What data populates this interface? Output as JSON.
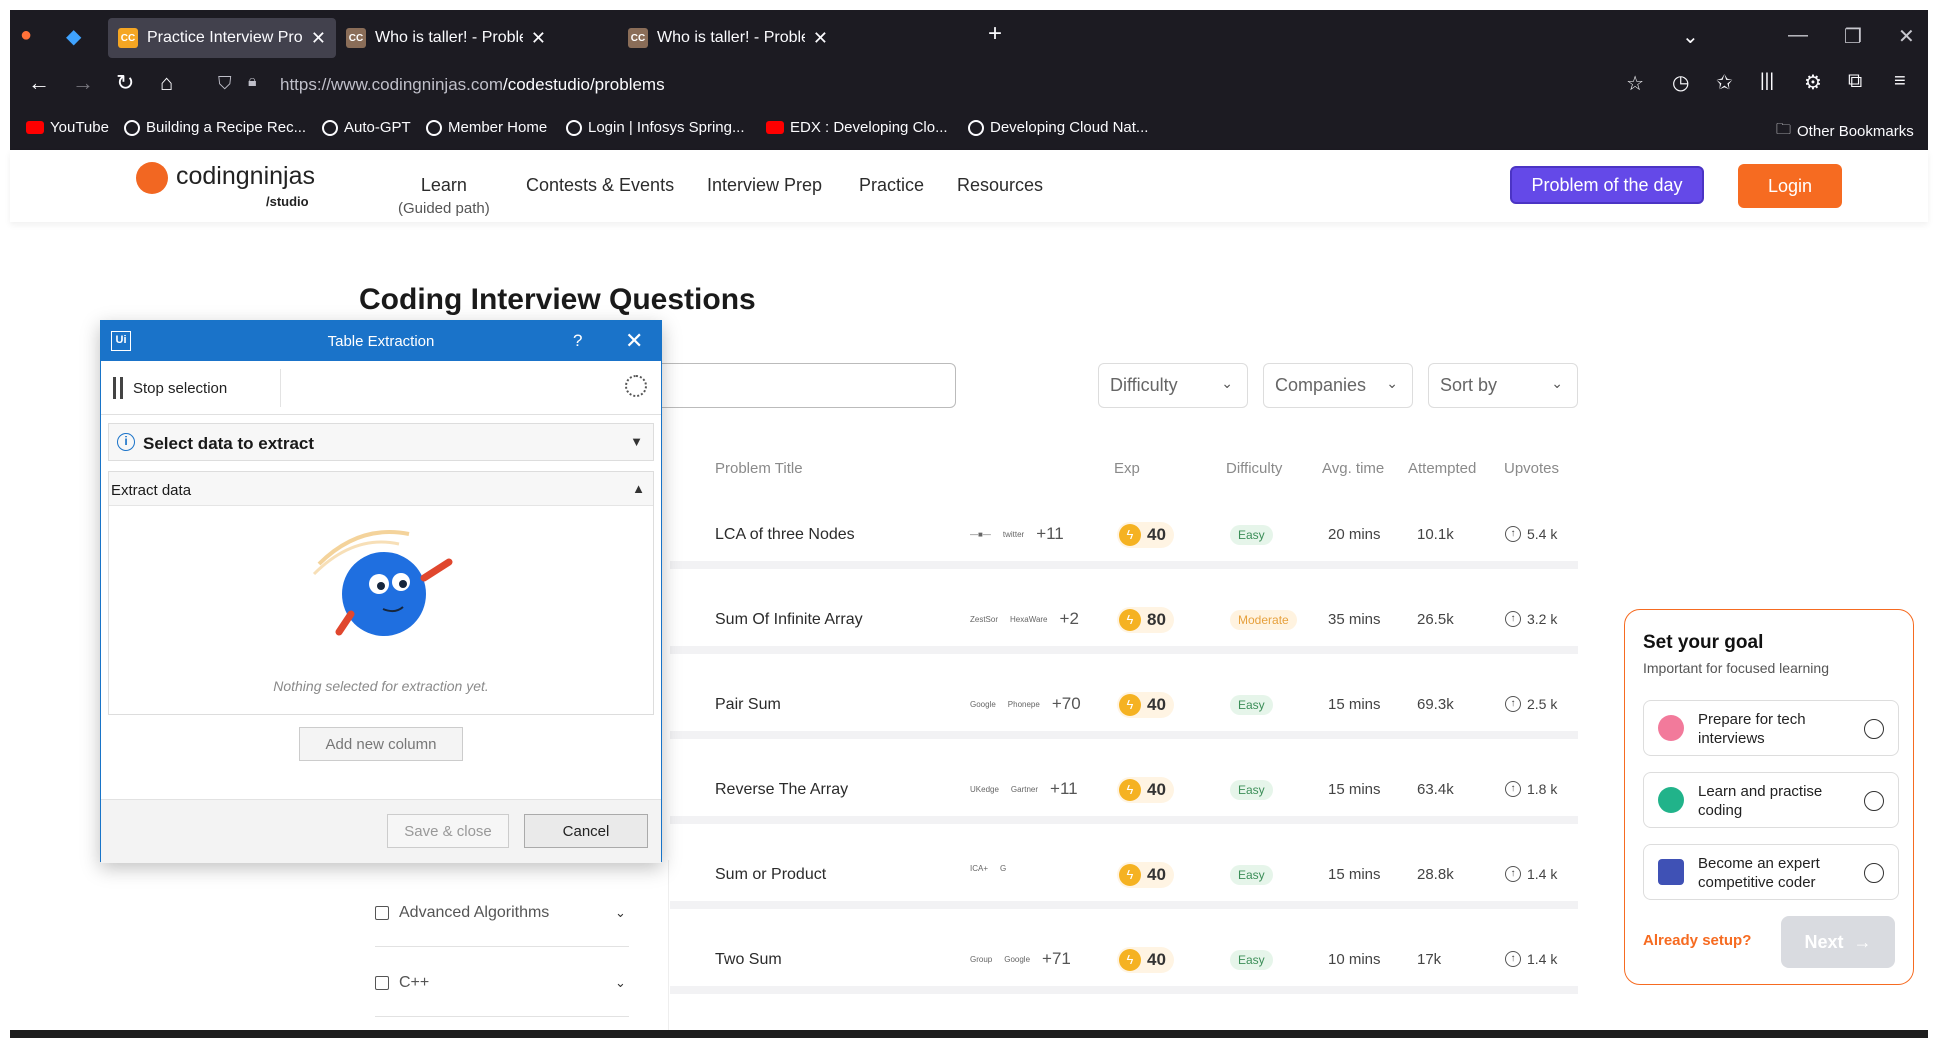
{
  "browser": {
    "tabs": [
      {
        "title": "Practice Interview Problems of t",
        "favicon": "CC",
        "active": true
      },
      {
        "title": "Who is taller! - Problems - Cod",
        "favicon": "CC",
        "active": false
      },
      {
        "title": "Who is taller! - Problems - Cod",
        "favicon": "CC",
        "active": false
      }
    ],
    "url_host": "https://www.codingninjas.com",
    "url_path": "/codestudio/problems",
    "bookmarks": [
      {
        "label": "YouTube",
        "icon": "youtube-icon"
      },
      {
        "label": "Building a Recipe Rec...",
        "icon": "globe-icon"
      },
      {
        "label": "Auto-GPT",
        "icon": "github-icon"
      },
      {
        "label": "Member Home",
        "icon": "globe-icon"
      },
      {
        "label": "Login | Infosys Spring...",
        "icon": "infosys-icon"
      },
      {
        "label": "EDX : Developing Clo...",
        "icon": "youtube-icon"
      },
      {
        "label": "Developing Cloud Nat...",
        "icon": "globe-icon"
      }
    ],
    "other_bookmarks": "Other Bookmarks"
  },
  "site": {
    "logo_word": "codingninjas",
    "logo_sub": "/studio",
    "nav": [
      {
        "label": "Learn",
        "sub": "(Guided path)"
      },
      {
        "label": "Contests & Events",
        "sub": ""
      },
      {
        "label": "Interview Prep",
        "sub": ""
      },
      {
        "label": "Practice",
        "sub": ""
      },
      {
        "label": "Resources",
        "sub": ""
      }
    ],
    "potd": "Problem of the day",
    "login": "Login"
  },
  "page": {
    "title": "Coding Interview Questions",
    "filters": [
      "Difficulty",
      "Companies",
      "Sort by"
    ],
    "columns": [
      "Problem Title",
      "Exp",
      "Difficulty",
      "Avg. time",
      "Attempted",
      "Upvotes"
    ],
    "rows": [
      {
        "title": "LCA of three Nodes",
        "logo1": "—■—",
        "logo2": "twitter",
        "more": "+11",
        "exp": "40",
        "difficulty": "Easy",
        "time": "20 mins",
        "attempted": "10.1k",
        "upvotes": "5.4 k"
      },
      {
        "title": "Sum Of Infinite Array",
        "logo1": "ZestSor",
        "logo2": "HexaWare",
        "more": "+2",
        "exp": "80",
        "difficulty": "Moderate",
        "time": "35 mins",
        "attempted": "26.5k",
        "upvotes": "3.2 k"
      },
      {
        "title": "Pair Sum",
        "logo1": "Google",
        "logo2": "Phonepe",
        "more": "+70",
        "exp": "40",
        "difficulty": "Easy",
        "time": "15 mins",
        "attempted": "69.3k",
        "upvotes": "2.5 k"
      },
      {
        "title": "Reverse The Array",
        "logo1": "UKedge",
        "logo2": "Gartner",
        "more": "+11",
        "exp": "40",
        "difficulty": "Easy",
        "time": "15 mins",
        "attempted": "63.4k",
        "upvotes": "1.8 k"
      },
      {
        "title": "Sum or Product",
        "logo1": "ICA+",
        "logo2": "G",
        "more": "",
        "exp": "40",
        "difficulty": "Easy",
        "time": "15 mins",
        "attempted": "28.8k",
        "upvotes": "1.4 k"
      },
      {
        "title": "Two Sum",
        "logo1": "Group",
        "logo2": "Google",
        "more": "+71",
        "exp": "40",
        "difficulty": "Easy",
        "time": "10 mins",
        "attempted": "17k",
        "upvotes": "1.4 k"
      }
    ],
    "topics": [
      "Advanced Algorithms",
      "C++"
    ]
  },
  "goal": {
    "title": "Set your goal",
    "subtitle": "Important for focused learning",
    "options": [
      {
        "label": "Prepare for tech interviews",
        "icon": "person-icon",
        "color": "#f27a9b"
      },
      {
        "label": "Learn and practise coding",
        "icon": "code-icon",
        "color": "#21b38a"
      },
      {
        "label": "Become an expert competitive coder",
        "icon": "trophy-icon",
        "color": "#3f51b5"
      }
    ],
    "already": "Already setup?",
    "next": "Next"
  },
  "dialog": {
    "logo": "Ui",
    "title": "Table Extraction",
    "help": "?",
    "stop_selection": "Stop selection",
    "select_section": "Select data to extract",
    "extract_section": "Extract data",
    "empty_text": "Nothing selected for extraction yet.",
    "add_column": "Add new column",
    "save_close": "Save & close",
    "cancel": "Cancel"
  },
  "colors": {
    "brand_orange": "#f66b21",
    "potd_purple": "#6449e8",
    "dialog_blue": "#1a73c9",
    "browser_dark": "#1c1b22"
  }
}
